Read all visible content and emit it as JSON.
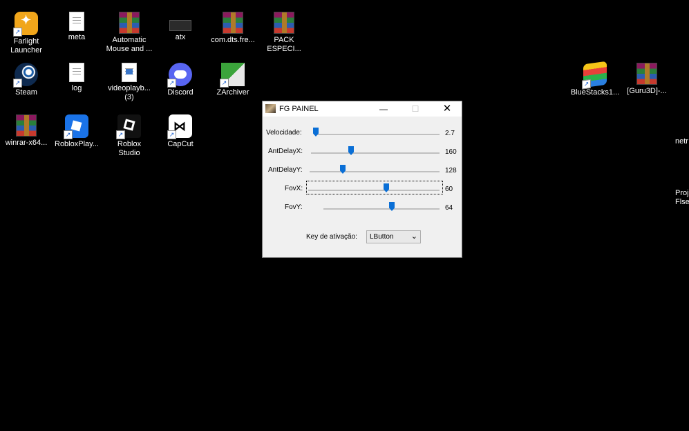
{
  "desktop": {
    "icons": [
      {
        "label": "Farlight\nLauncher"
      },
      {
        "label": "meta"
      },
      {
        "label": "Automatic\nMouse and ..."
      },
      {
        "label": "atx"
      },
      {
        "label": "com.dts.fre..."
      },
      {
        "label": "PACK\nESPECI..."
      },
      {
        "label": "Steam"
      },
      {
        "label": "log"
      },
      {
        "label": "videoplayb...\n(3)"
      },
      {
        "label": "Discord"
      },
      {
        "label": "ZArchiver"
      },
      {
        "label": "winrar-x64..."
      },
      {
        "label": "RobloxPlay..."
      },
      {
        "label": "Roblox\nStudio"
      },
      {
        "label": "CapCut"
      },
      {
        "label": "BlueStacks1..."
      },
      {
        "label": "[Guru3D]-..."
      }
    ],
    "edge_labels": [
      "netr",
      "Proj",
      "Flse"
    ]
  },
  "window": {
    "title": "FG PAINEL",
    "minimize_glyph": "—",
    "maximize_glyph": "☐",
    "close_glyph": "✕",
    "sliders": [
      {
        "label": "Velocidade:",
        "value": "2.7",
        "position": 0.0
      },
      {
        "label": "AntDelayX:",
        "value": "160",
        "position": 0.3
      },
      {
        "label": "AntDelayY:",
        "value": "128",
        "position": 0.25
      },
      {
        "label": "FovX:",
        "value": "60",
        "position": 0.6
      },
      {
        "label": "FovY:",
        "value": "64",
        "position": 0.6
      }
    ],
    "key_label": "Key de ativação:",
    "key_value": "LButton",
    "dropdown_arrow": "⌄"
  },
  "colors": {
    "slider_thumb": "#0a6fd6",
    "desktop_bg": "#000000"
  }
}
